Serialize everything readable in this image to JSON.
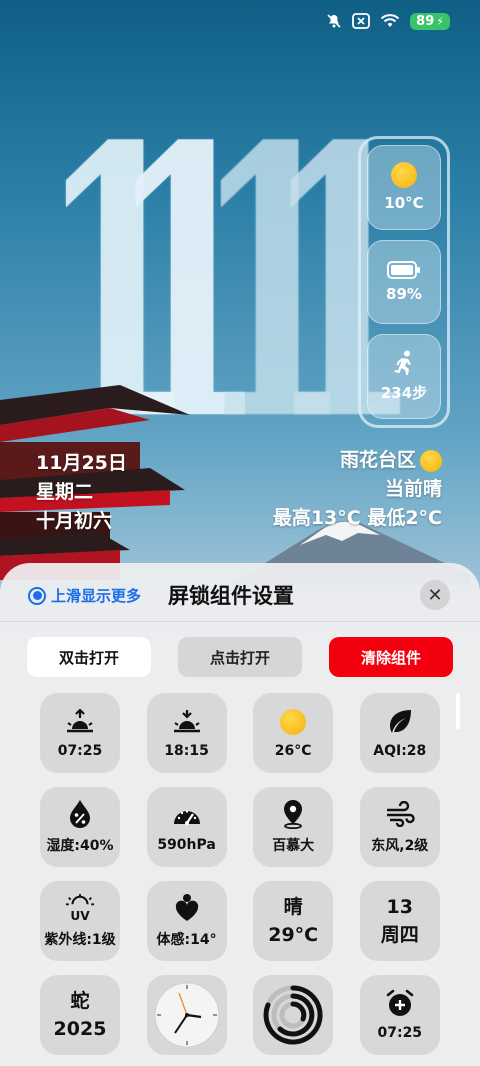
{
  "status_bar": {
    "icons": [
      "mute-icon",
      "close-box-icon",
      "wifi-icon"
    ],
    "battery": "89"
  },
  "clock": {
    "digits": [
      "1",
      "1",
      "1",
      "1"
    ]
  },
  "side_widgets": [
    {
      "icon": "sun-icon",
      "value": "10°C"
    },
    {
      "icon": "battery-icon",
      "value": "89%"
    },
    {
      "icon": "runner-icon",
      "value": "234步"
    }
  ],
  "date": {
    "line1": "11月25日",
    "line2": "星期二",
    "line3": "十月初六"
  },
  "weather": {
    "location": "雨花台区",
    "condition": "当前晴",
    "range": "最高13°C 最低2°C"
  },
  "sheet": {
    "hint": "上滑显示更多",
    "title": "屏锁组件设置",
    "buttons": {
      "double_tap": "双击打开",
      "tap": "点击打开",
      "clear": "清除组件"
    },
    "tiles": [
      {
        "icon": "sunrise-icon",
        "label": "07:25"
      },
      {
        "icon": "sunset-icon",
        "label": "18:15"
      },
      {
        "icon": "sun-icon",
        "label": "26°C"
      },
      {
        "icon": "leaf-icon",
        "label": "AQI:28"
      },
      {
        "icon": "humidity-icon",
        "label": "湿度:40%"
      },
      {
        "icon": "gauge-icon",
        "label": "590hPa"
      },
      {
        "icon": "location-pin-icon",
        "label": "百慕大"
      },
      {
        "icon": "wind-icon",
        "label": "东风,2级"
      },
      {
        "icon": "uv-icon",
        "label": "紫外线:1级"
      },
      {
        "icon": "heart-body-icon",
        "label": "体感:14°"
      },
      {
        "text_top": "晴",
        "text_bottom": "29°C"
      },
      {
        "text_top": "13",
        "text_bottom": "周四"
      },
      {
        "text_top": "蛇",
        "text_bottom": "2025"
      },
      {
        "icon": "analog-clock-icon",
        "label": ""
      },
      {
        "icon": "activity-ring-icon",
        "label": ""
      },
      {
        "icon": "alarm-icon",
        "label": "07:25"
      }
    ]
  }
}
